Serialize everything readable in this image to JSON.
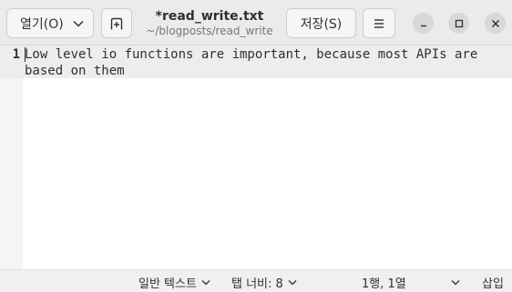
{
  "header": {
    "open_label": "열기(O)",
    "title": "*read_write.txt",
    "subtitle": "~/blogposts/read_write",
    "save_label": "저장(S)"
  },
  "icons": {
    "open_dropdown": "chevron-down-icon",
    "new_tab": "new-tab-icon",
    "menu": "hamburger-menu-icon",
    "minimize": "minimize-icon",
    "maximize": "maximize-icon",
    "close": "close-icon"
  },
  "editor": {
    "line_number": "1",
    "text": "Low level io functions are important, because most APIs are based on them"
  },
  "statusbar": {
    "language": "일반 텍스트",
    "tab_width": "탭 너비: 8",
    "cursor_position": "1행, 1열",
    "insert_mode": "삽입"
  }
}
